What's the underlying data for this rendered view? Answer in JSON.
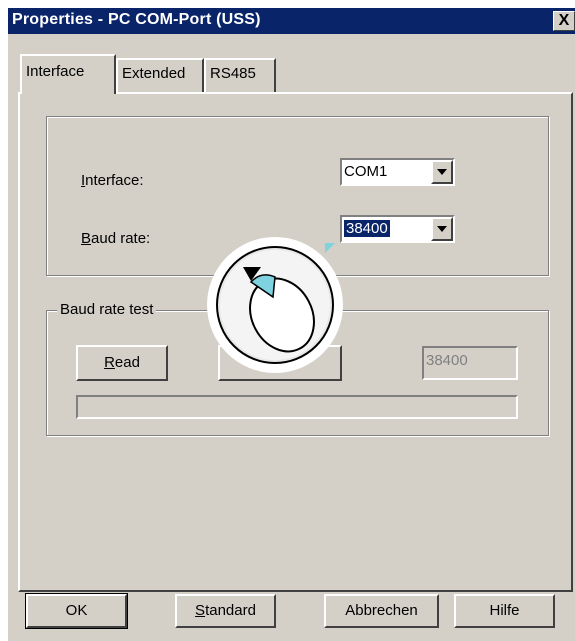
{
  "window": {
    "title": "Properties - PC COM-Port (USS)",
    "close_symbol": "X"
  },
  "tabs": [
    {
      "label": "Interface"
    },
    {
      "label": "Extended"
    },
    {
      "label": "RS485"
    }
  ],
  "interface_group": {
    "interface_label_key": "I",
    "interface_label_rest": "nterface:",
    "interface_value": "COM1",
    "baud_label_key": "B",
    "baud_label_rest": "aud rate:",
    "baud_value": "38400"
  },
  "baud_test_group": {
    "title": "Baud rate test",
    "read_key": "R",
    "read_rest": "ead",
    "result_value": "38400",
    "progress": 0
  },
  "footer": {
    "ok_label": "OK",
    "standard_key": "S",
    "standard_rest": "tandard",
    "cancel_label": "Abbrechen",
    "help_label": "Hilfe"
  },
  "colors": {
    "face": "#d4d0c8",
    "title_bar": "#0a246a",
    "selection": "#0a246a",
    "cursor_accent": "#7fd3e0"
  },
  "icons": {
    "cursor": "mouse-pointer-icon"
  }
}
